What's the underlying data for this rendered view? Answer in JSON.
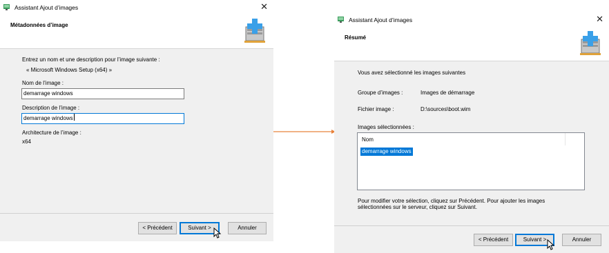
{
  "left_window": {
    "title": "Assistant Ajout d’images",
    "heading": "Métadonnées d’image",
    "intro_line1": "Entrez un nom et une description pour l’image suivante :",
    "intro_line2": "« Microsoft Windows Setup (x64) »",
    "name_label": "Nom de l’image :",
    "name_value": "demarrage windows",
    "desc_label": "Description de l’image :",
    "desc_value": "demarrage windows",
    "arch_label": "Architecture de l’image :",
    "arch_value": "x64",
    "buttons": {
      "previous": "< Précédent",
      "next": "Suivant >",
      "cancel": "Annuler"
    }
  },
  "right_window": {
    "title": "Assistant Ajout d’images",
    "heading": "Résumé",
    "intro": "Vous avez sélectionné les images suivantes",
    "group_label": "Groupe d’images :",
    "group_value": "Images de démarrage",
    "file_label": "Fichier image :",
    "file_value": "D:\\sources\\boot.wim",
    "selected_label": "Images sélectionnées :",
    "list_column": "Nom",
    "list_items": [
      "demarrage windows"
    ],
    "footer_text_line1": "Pour modifier votre sélection, cliquez sur Précédent. Pour ajouter les images",
    "footer_text_line2": "sélectionnées sur le serveur, cliquez sur Suivant.",
    "buttons": {
      "previous": "< Précédent",
      "next": "Suivant >",
      "cancel": "Annuler"
    }
  },
  "colors": {
    "accent": "#0078d7",
    "panel": "#f0f0f0",
    "arrow": "#e8823a"
  },
  "icons": [
    "wds-app-icon",
    "add-image-wizard-icon",
    "close-icon",
    "mouse-pointer-icon"
  ]
}
